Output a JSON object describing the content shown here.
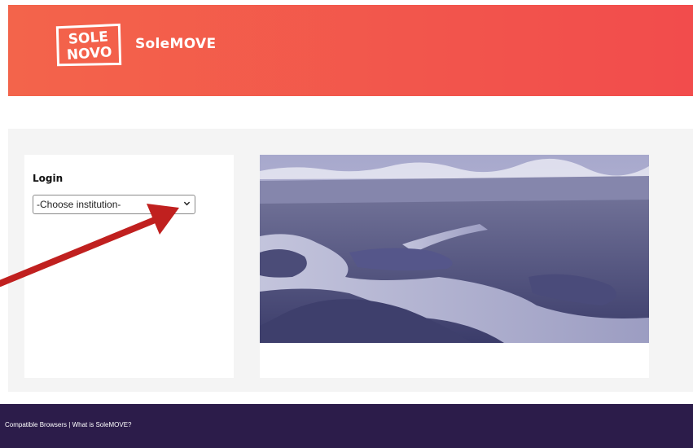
{
  "header": {
    "logo_text": [
      "SOLE",
      "NOVO"
    ],
    "brand": "SoleMOVE",
    "gradient": [
      "#f3644b",
      "#f24c4c"
    ]
  },
  "login": {
    "title": "Login",
    "institution_select": "-Choose institution-"
  },
  "footer": {
    "link1": "Compatible Browsers",
    "separator": " | ",
    "link2": "What is SoleMOVE?"
  },
  "colors": {
    "footer_bg": "#2c1c4a",
    "content_bg": "#f4f4f4",
    "arrow": "#c0201f"
  }
}
